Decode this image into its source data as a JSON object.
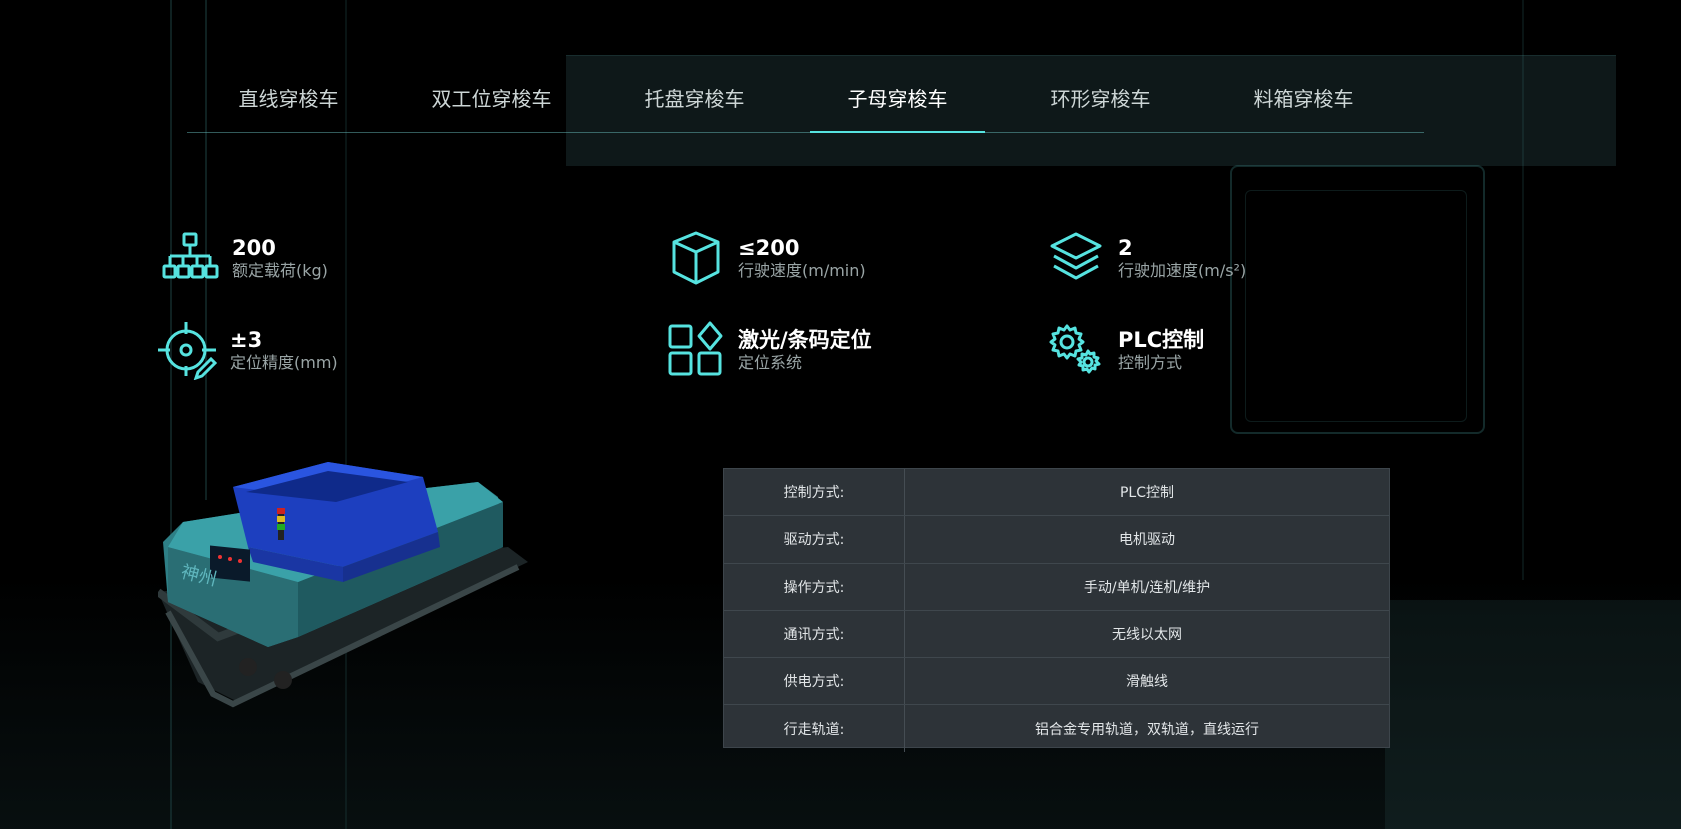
{
  "tabs": [
    {
      "label": "直线穿梭车",
      "active": false
    },
    {
      "label": "双工位穿梭车",
      "active": false
    },
    {
      "label": "托盘穿梭车",
      "active": false
    },
    {
      "label": "子母穿梭车",
      "active": true
    },
    {
      "label": "环形穿梭车",
      "active": false
    },
    {
      "label": "料箱穿梭车",
      "active": false
    }
  ],
  "stats": [
    {
      "icon": "org-chart-icon",
      "value": "200",
      "label": "额定载荷(kg)"
    },
    {
      "icon": "cube-icon",
      "value": "≤200",
      "label": "行驶速度(m/min)"
    },
    {
      "icon": "layers-icon",
      "value": "2",
      "label": "行驶加速度(m/s²)"
    },
    {
      "icon": "target-pencil-icon",
      "value": "±3",
      "label": "定位精度(mm)"
    },
    {
      "icon": "grid-diamond-icon",
      "value": "激光/条码定位",
      "label": "定位系统"
    },
    {
      "icon": "gears-icon",
      "value": "PLC控制",
      "label": "控制方式"
    }
  ],
  "specs": [
    {
      "key": "控制方式:",
      "value": "PLC控制"
    },
    {
      "key": "驱动方式:",
      "value": "电机驱动"
    },
    {
      "key": "操作方式:",
      "value": "手动/单机/连机/维护"
    },
    {
      "key": "通讯方式:",
      "value": "无线以太网"
    },
    {
      "key": "供电方式:",
      "value": "滑触线"
    },
    {
      "key": "行走轨道:",
      "value": "铝合金专用轨道，双轨道，直线运行"
    }
  ],
  "colors": {
    "accent": "#56e3e0",
    "table_bg": "#2d3338"
  }
}
